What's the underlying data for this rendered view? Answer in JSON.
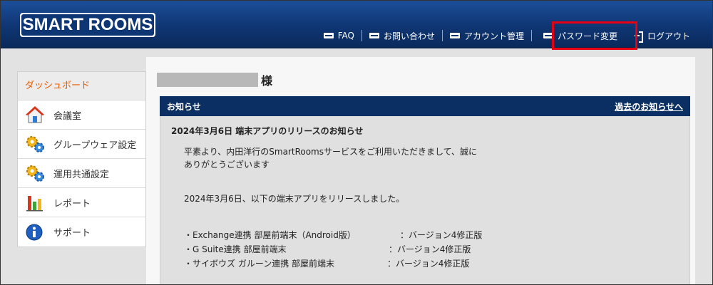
{
  "header": {
    "logo_text": "SMART ROOMS",
    "nav": {
      "faq": "FAQ",
      "contact": "お問い合わせ",
      "account": "アカウント管理",
      "password": "パスワード変更",
      "logout": "ログアウト"
    }
  },
  "sidebar": {
    "title": "ダッシュボード",
    "items": [
      {
        "label": "会議室",
        "icon": "house-icon"
      },
      {
        "label": "グループウェア設定",
        "icon": "gears-icon"
      },
      {
        "label": "運用共通設定",
        "icon": "gears-icon"
      },
      {
        "label": "レポート",
        "icon": "bar-chart-icon"
      },
      {
        "label": "サポート",
        "icon": "info-icon"
      }
    ]
  },
  "main": {
    "honorific": "様",
    "notice": {
      "title": "お知らせ",
      "past_link": "過去のお知らせへ",
      "headline": "2024年3月6日 端末アプリのリリースのお知らせ",
      "greeting_line1": "平素より、内田洋行のSmartRoomsサービスをご利用いただきまして、誠に",
      "greeting_line2": "ありがとうございます",
      "intro": "2024年3月6日、以下の端末アプリをリリースしました。",
      "releases": [
        {
          "name": "・Exchange連携 部屋前端末（Android版）",
          "version": "：バージョン4修正版"
        },
        {
          "name": "・G Suite連携 部屋前端末",
          "version": "：バージョン4修正版"
        },
        {
          "name": "・サイボウズ ガルーン連携 部屋前端末",
          "version": "：バージョン4修正版"
        }
      ]
    }
  },
  "colors": {
    "header_blue": "#0f3674",
    "accent_orange": "#e65c00",
    "highlight_red": "#e60012",
    "notice_bar": "#0b2f62"
  }
}
